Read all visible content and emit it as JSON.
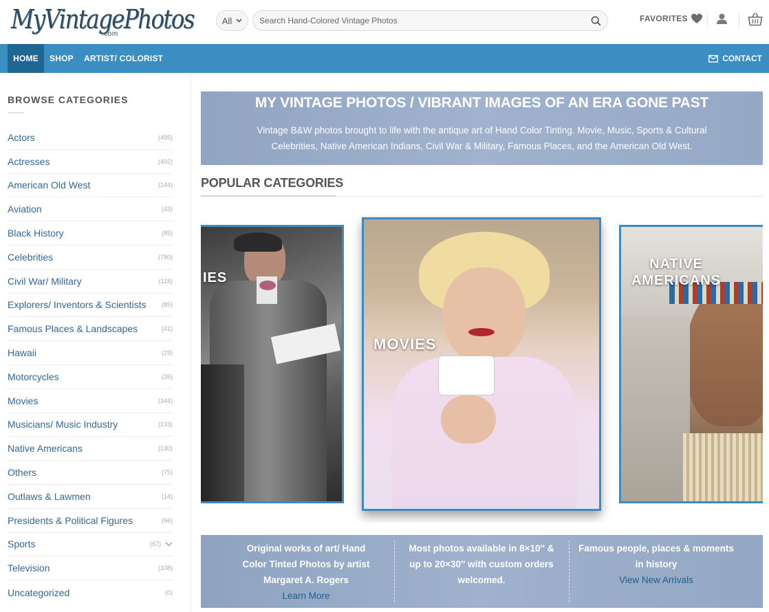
{
  "header": {
    "logo_text": "MyVintagePhotos",
    "logo_suffix": ".com",
    "category_select": "All",
    "search_placeholder": "Search Hand-Colored Vintage Photos",
    "favorites_label": "FAVORITES"
  },
  "nav": {
    "items": [
      {
        "label": "HOME",
        "active": true
      },
      {
        "label": "SHOP",
        "active": false
      },
      {
        "label": "ARTIST/ COLORIST",
        "active": false
      }
    ],
    "contact_label": "CONTACT"
  },
  "sidebar": {
    "title": "BROWSE CATEGORIES",
    "categories": [
      {
        "label": "Actors",
        "count": "(495)"
      },
      {
        "label": "Actresses",
        "count": "(402)"
      },
      {
        "label": "American Old West",
        "count": "(144)"
      },
      {
        "label": "Aviation",
        "count": "(43)"
      },
      {
        "label": "Black History",
        "count": "(85)"
      },
      {
        "label": "Celebrities",
        "count": "(780)"
      },
      {
        "label": "Civil War/ Military",
        "count": "(118)"
      },
      {
        "label": "Explorers/ Inventors & Scientists",
        "count": "(85)"
      },
      {
        "label": "Famous Places & Landscapes",
        "count": "(41)"
      },
      {
        "label": "Hawaii",
        "count": "(29)"
      },
      {
        "label": "Motorcycles",
        "count": "(35)"
      },
      {
        "label": "Movies",
        "count": "(344)"
      },
      {
        "label": "Musicians/ Music Industry",
        "count": "(133)"
      },
      {
        "label": "Native Americans",
        "count": "(130)"
      },
      {
        "label": "Others",
        "count": "(75)"
      },
      {
        "label": "Outlaws & Lawmen",
        "count": "(14)"
      },
      {
        "label": "Presidents & Political Figures",
        "count": "(66)"
      },
      {
        "label": "Sports",
        "count": "(67)"
      },
      {
        "label": "Television",
        "count": "(108)"
      },
      {
        "label": "Uncategorized",
        "count": "(0)"
      }
    ]
  },
  "hero": {
    "title": "MY VINTAGE PHOTOS / VIBRANT IMAGES OF AN ERA GONE PAST",
    "subtitle": "Vintage B&W photos brought to life with the antique art of Hand Color Tinting. Movie, Music, Sports & Cultural Celebrities, Native American Indians, Civil War & Military, Famous Places, and the American Old West."
  },
  "popular": {
    "title": "POPULAR CATEGORIES",
    "slides": {
      "left_label": "IES",
      "center_label": "MOVIES",
      "right_label_line1": "NATIVE",
      "right_label_line2": "AMERICANS"
    }
  },
  "info": {
    "col1_text": "Original works of art/ Hand Color Tinted Photos by artist Margaret A. Rogers",
    "col1_link": "Learn More",
    "col2_text": "Most photos available in 8×10″ & up to 20×30″ with custom orders welcomed.",
    "col3_text": "Famous people, places & moments in history",
    "col3_link": "View New Arrivals"
  },
  "colors": {
    "nav_bg": "#3b8ec2",
    "nav_active": "#1f6692",
    "link": "#336699",
    "hero_bg": "#9db0cb",
    "slide_border": "#3e8ac0"
  }
}
